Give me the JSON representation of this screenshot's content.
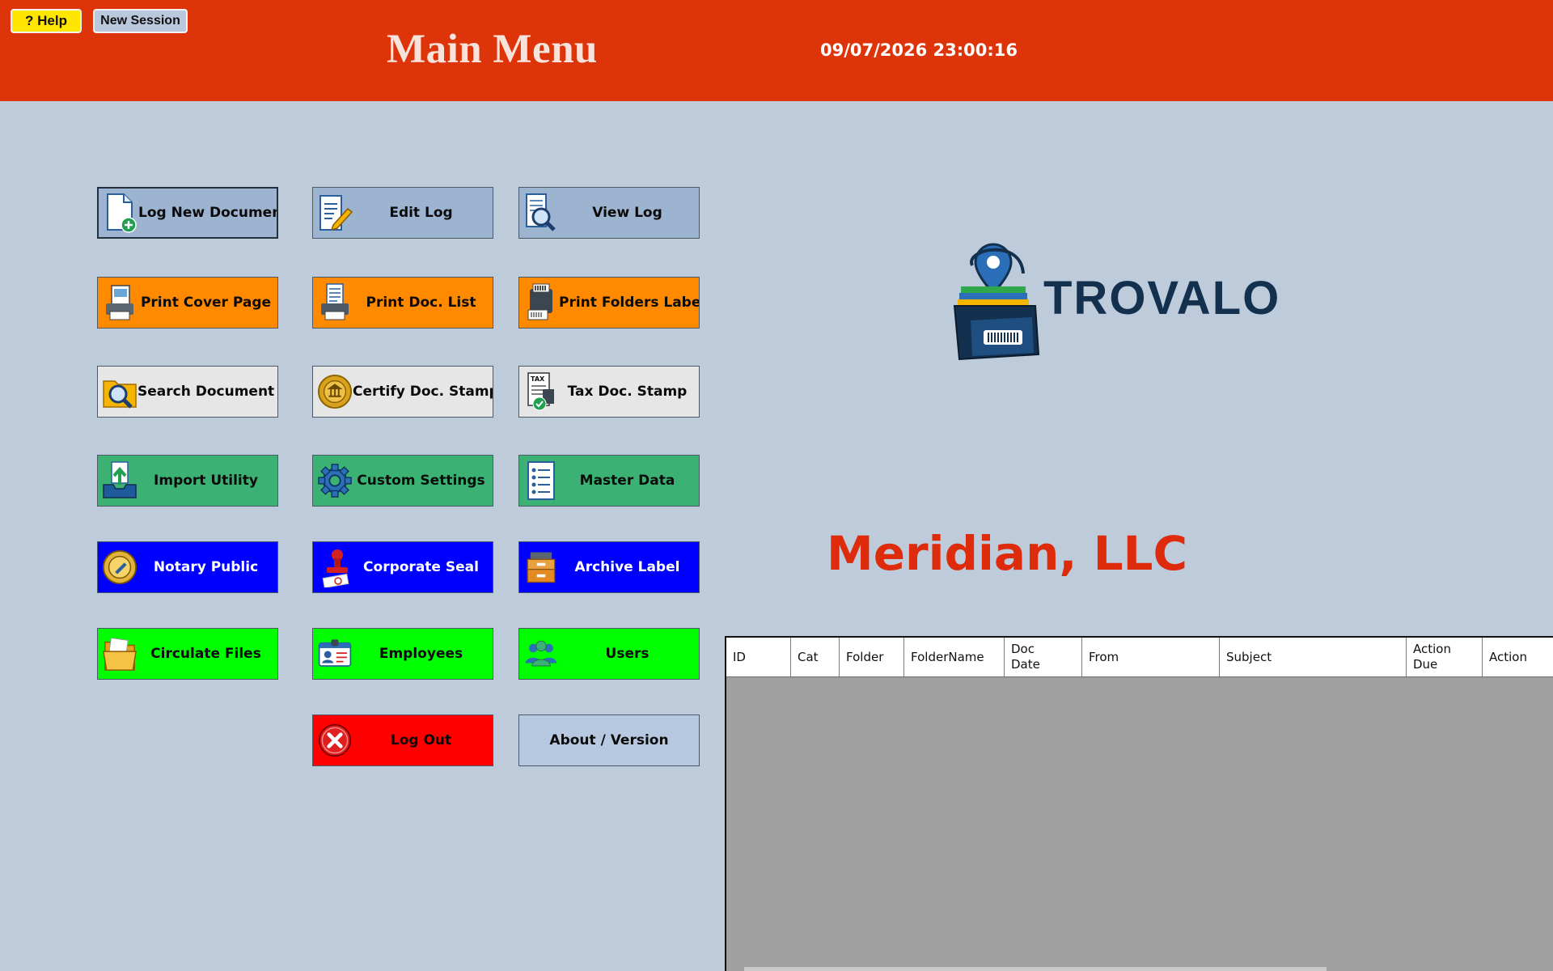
{
  "header": {
    "help_label": "? Help",
    "new_session_label": "New Session",
    "title": "Main Menu",
    "datetime": "09/07/2026 23:00:16"
  },
  "menu": {
    "log_new_document": "Log New Document",
    "edit_log": "Edit Log",
    "view_log": "View Log",
    "print_cover_page": "Print Cover Page",
    "print_doc_list": "Print Doc. List",
    "print_folders_labels": "Print Folders Labels",
    "search_document": "Search Document",
    "certify_doc_stamp": "Certify Doc. Stamp",
    "tax_doc_stamp": "Tax Doc. Stamp",
    "import_utility": "Import Utility",
    "custom_settings": "Custom Settings",
    "master_data": "Master Data",
    "notary_public": "Notary Public",
    "corporate_seal": "Corporate Seal",
    "archive_label": "Archive Label",
    "circulate_files": "Circulate Files",
    "employees": "Employees",
    "users": "Users",
    "log_out": "Log Out",
    "about_version": "About / Version"
  },
  "brand": {
    "logo_text": "TROVALO",
    "company": "Meridian, LLC"
  },
  "table": {
    "columns": [
      "ID",
      "Cat",
      "Folder",
      "FolderName",
      "Doc\nDate",
      "From",
      "Subject",
      "Action\nDue",
      "Action"
    ]
  },
  "colors": {
    "header_bg": "#de3409",
    "page_bg": "#bdcbdb",
    "company_text": "#de2b0c",
    "logo_navy": "#13304f",
    "logo_green": "#2ea84a"
  },
  "icons": {
    "log_new_document": "document-plus-icon",
    "edit_log": "edit-document-icon",
    "view_log": "magnifier-document-icon",
    "print_cover_page": "printer-photo-icon",
    "print_doc_list": "printer-list-icon",
    "print_folders_labels": "label-printer-icon",
    "search_document": "folder-search-icon",
    "certify_doc_stamp": "corporate-seal-badge-icon",
    "tax_doc_stamp": "tax-document-check-icon",
    "import_utility": "inbox-upload-icon",
    "custom_settings": "gear-icon",
    "master_data": "checklist-icon",
    "notary_public": "notary-seal-icon",
    "corporate_seal": "rubber-stamp-icon",
    "archive_label": "archive-boxes-icon",
    "circulate_files": "folder-icon",
    "employees": "id-card-icon",
    "users": "users-group-icon",
    "log_out": "close-circle-icon"
  }
}
